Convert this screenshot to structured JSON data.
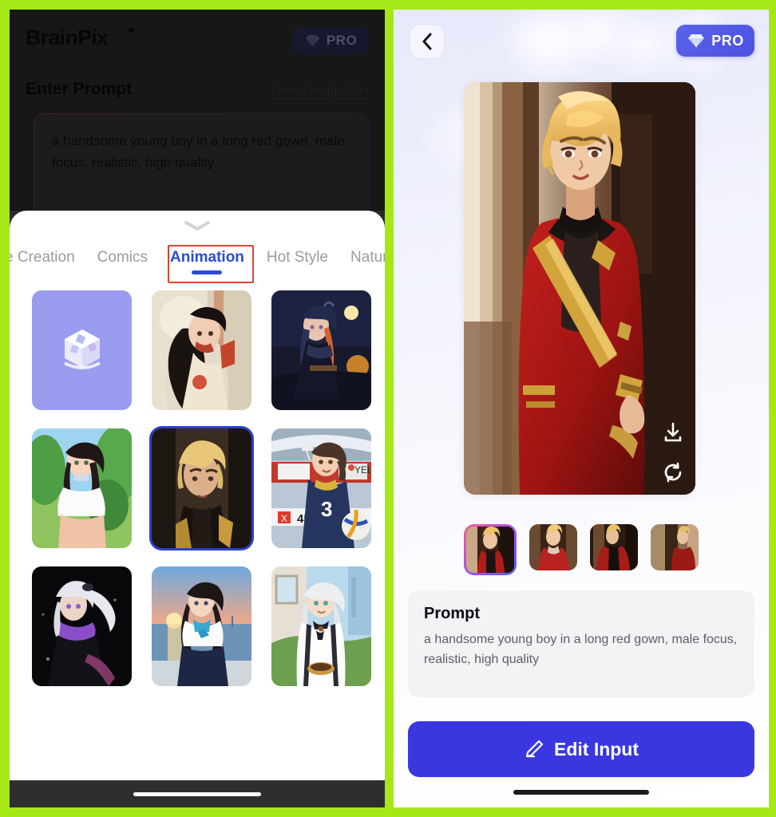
{
  "frame": {
    "accent_green": "#a6e817"
  },
  "left": {
    "brand": "BrainPix",
    "brand_star": "✦",
    "pro_label": "PRO",
    "enter_prompt_label": "Enter Prompt",
    "inspiration_link": "I need inspiration",
    "prompt_value": "a handsome young boy in a long red gown, male focus, realistic, high quality",
    "prompt_placeholder": "Enter Prompt",
    "sheet": {
      "handle_icon": "chevron-down-icon",
      "tabs": [
        {
          "label": "e Creation",
          "active": false,
          "partial": true
        },
        {
          "label": "Comics",
          "active": false,
          "partial": false
        },
        {
          "label": "Animation",
          "active": true,
          "partial": false
        },
        {
          "label": "Hot Style",
          "active": false,
          "partial": false
        },
        {
          "label": "Natural",
          "active": false,
          "partial": false
        }
      ],
      "styles": [
        {
          "name": "random-style",
          "type": "dice",
          "selected": false
        },
        {
          "name": "style-kimono-girl",
          "type": "image",
          "selected": false
        },
        {
          "name": "style-moonlight-warrior",
          "type": "image",
          "selected": false
        },
        {
          "name": "style-summer-park-girl",
          "type": "image",
          "selected": false
        },
        {
          "name": "style-blonde-knight",
          "type": "image",
          "selected": true
        },
        {
          "name": "style-volleyball-girl",
          "type": "image",
          "selected": false
        },
        {
          "name": "style-white-hair-mage",
          "type": "image",
          "selected": false
        },
        {
          "name": "style-sunset-sailor",
          "type": "image",
          "selected": false
        },
        {
          "name": "style-white-hair-barista",
          "type": "image",
          "selected": false
        }
      ]
    }
  },
  "right": {
    "back_icon": "chevron-left-icon",
    "pro_label": "PRO",
    "hero": {
      "name": "generated-image-blonde-red-gown",
      "download_icon": "download-icon",
      "regenerate_icon": "refresh-icon"
    },
    "thumbnails": [
      {
        "name": "result-thumb-1",
        "selected": true
      },
      {
        "name": "result-thumb-2",
        "selected": false
      },
      {
        "name": "result-thumb-3",
        "selected": false
      },
      {
        "name": "result-thumb-4",
        "selected": false
      }
    ],
    "prompt_card": {
      "title": "Prompt",
      "text": "a handsome young boy in a long red gown, male focus, realistic, high quality"
    },
    "edit_button": {
      "label": "Edit Input",
      "icon": "pencil-icon"
    }
  }
}
